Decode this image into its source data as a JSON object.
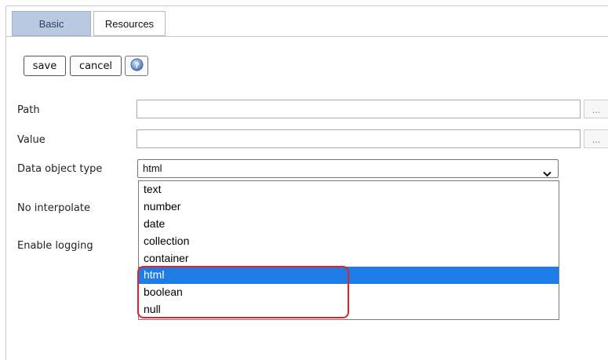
{
  "tabs": [
    {
      "label": "Basic",
      "active": true
    },
    {
      "label": "Resources",
      "active": false
    }
  ],
  "toolbar": {
    "save_label": "save",
    "cancel_label": "cancel",
    "help_icon": "help-icon"
  },
  "form": {
    "path": {
      "label": "Path",
      "value": "",
      "button": "..."
    },
    "value": {
      "label": "Value",
      "value": "",
      "button": "..."
    },
    "data_object_type": {
      "label": "Data object type",
      "selected": "html"
    },
    "no_interpolate": {
      "label": "No interpolate"
    },
    "enable_logging": {
      "label": "Enable logging"
    }
  },
  "dropdown": {
    "options": [
      "text",
      "number",
      "date",
      "collection",
      "container",
      "html",
      "boolean",
      "null"
    ],
    "highlighted": "html"
  },
  "colors": {
    "active_tab": "#b8c9e1",
    "selection": "#1e7ce7",
    "annotation": "#e5202b"
  }
}
